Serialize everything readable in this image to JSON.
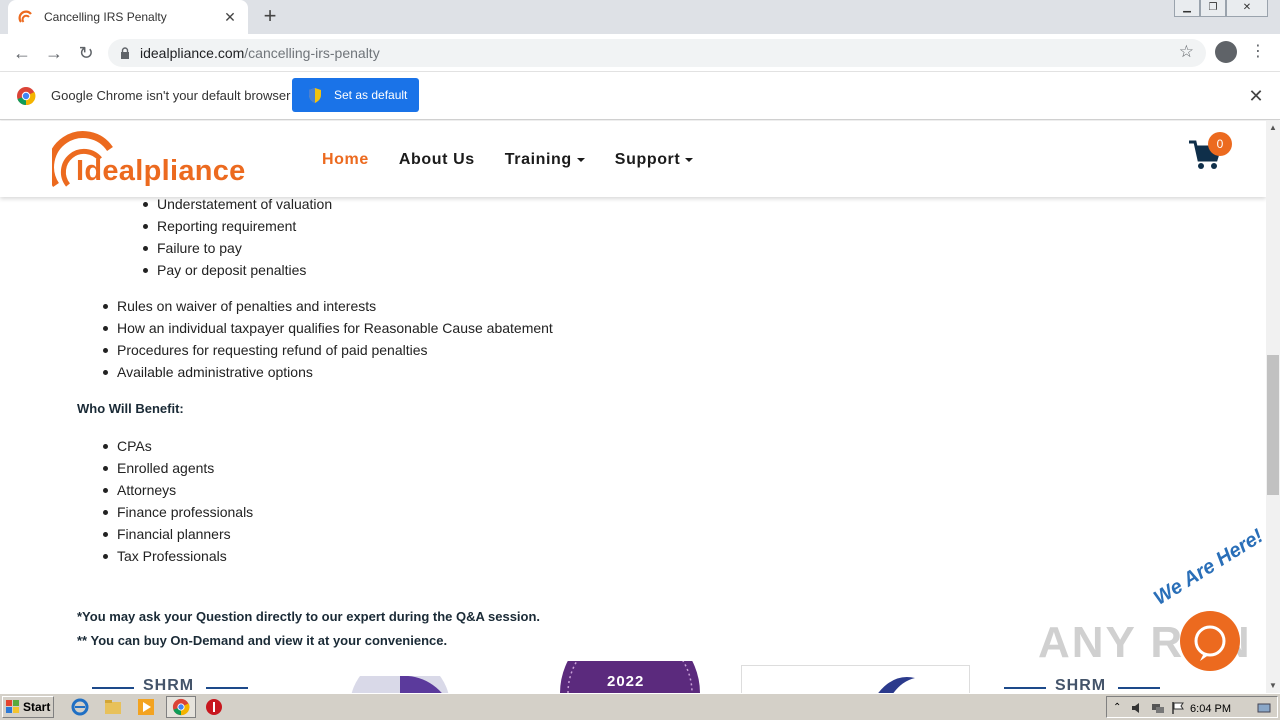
{
  "browser": {
    "tab_title": "Cancelling IRS Penalty",
    "url_host": "idealpliance.com",
    "url_path": "/cancelling-irs-penalty"
  },
  "infobar": {
    "message": "Google Chrome isn't your default browser",
    "button_label": "Set as default"
  },
  "site": {
    "logo_text": "Idealpliance",
    "nav": [
      {
        "label": "Home"
      },
      {
        "label": "About Us"
      },
      {
        "label": "Training"
      },
      {
        "label": "Support"
      }
    ],
    "cart_count": "0"
  },
  "content": {
    "sub_list": [
      "Understatement of valuation",
      "Reporting requirement",
      "Failure to pay",
      "Pay or deposit penalties"
    ],
    "main_list": [
      "Rules on waiver of penalties and interests",
      "How an individual taxpayer qualifies for Reasonable Cause abatement",
      "Procedures for requesting refund of paid penalties",
      "Available administrative options"
    ],
    "benefit_heading": "Who Will Benefit:",
    "benefit_list": [
      "CPAs",
      "Enrolled agents",
      "Attorneys",
      "Finance professionals",
      "Financial planners",
      "Tax Professionals"
    ],
    "note_1": "*You may ask your Question directly to our expert during the Q&A session.",
    "note_2": "** You can buy On-Demand and view it at your convenience."
  },
  "badges": {
    "shrm_1": "SHRM",
    "year": "2022",
    "shrm_2": "SHRM"
  },
  "overlay": {
    "watermark": "ANY RUN",
    "chat_label": "We Are Here!"
  },
  "taskbar": {
    "start_label": "Start",
    "clock": "6:04 PM"
  },
  "colors": {
    "brand_orange": "#ec6a1f",
    "chrome_blue": "#1a73e8"
  }
}
